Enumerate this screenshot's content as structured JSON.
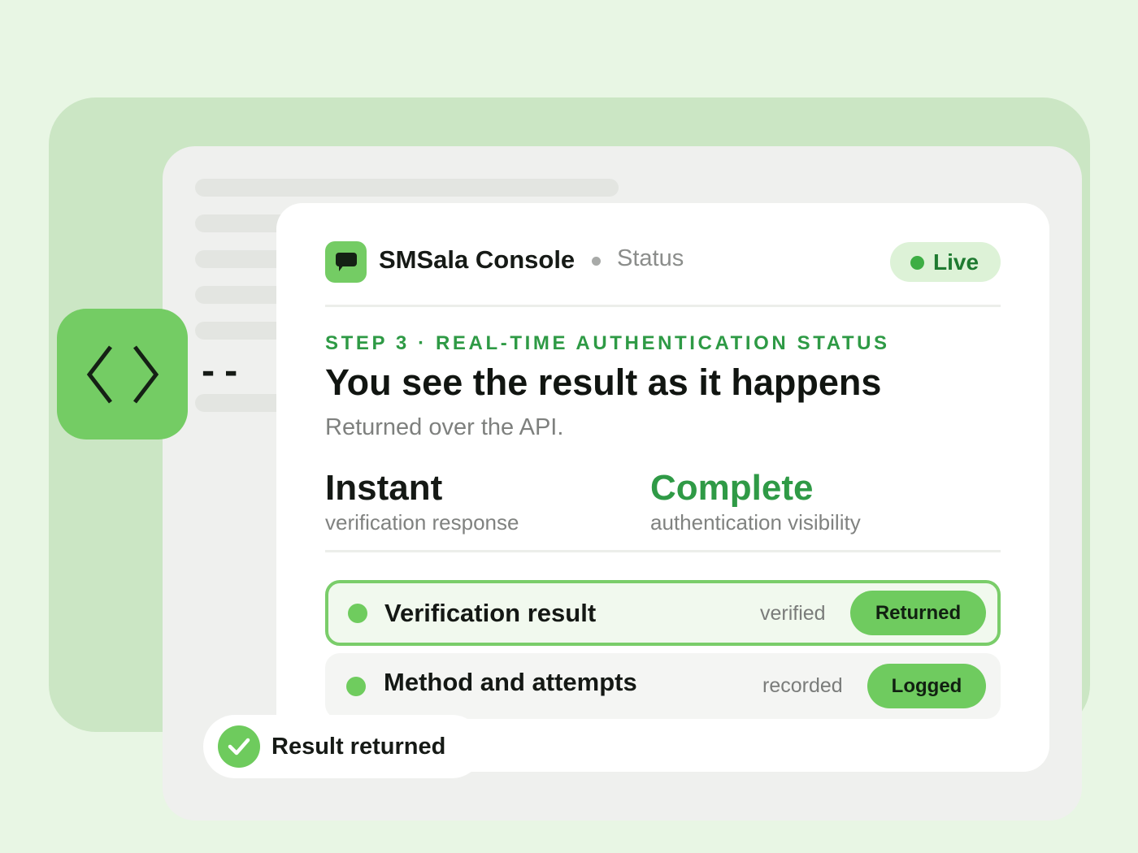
{
  "header": {
    "app_name": "SMSala Console",
    "section": "Status",
    "live_label": "Live",
    "app_icon": "chat-bubble-icon"
  },
  "step": {
    "eyebrow": "STEP 3 · REAL-TIME AUTHENTICATION STATUS",
    "headline": "You see the result as it happens",
    "subline": "Returned over the API."
  },
  "stats": [
    {
      "value": "Instant",
      "caption": "verification response",
      "color": "#151915"
    },
    {
      "value": "Complete",
      "caption": "authentication visibility",
      "color": "#2f9a46"
    }
  ],
  "rows": [
    {
      "title": "Verification result",
      "meta": "verified",
      "badge": "Returned",
      "highlighted": true
    },
    {
      "title": "Method and attempts",
      "meta": "recorded",
      "badge": "Logged",
      "highlighted": false
    }
  ],
  "toast": {
    "label": "Result returned",
    "icon": "check-icon"
  },
  "side": {
    "icon": "code-brackets-icon",
    "dashes": "--"
  },
  "colors": {
    "accent_green": "#74cc64",
    "text_green": "#2f9a46",
    "page_bg": "#e8f6e4",
    "panel_bg": "#cbe6c4"
  }
}
